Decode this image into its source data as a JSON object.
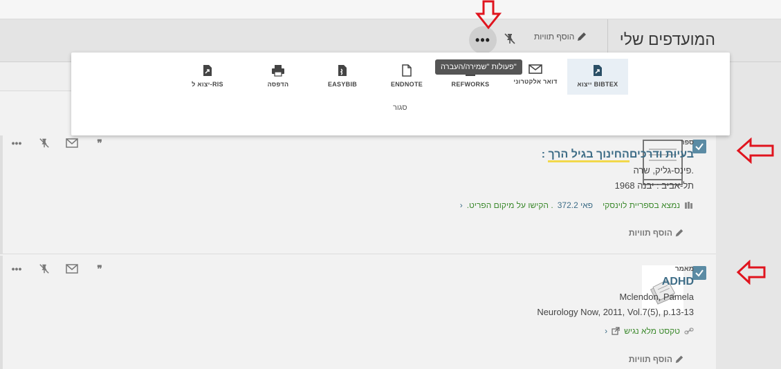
{
  "header": {
    "page_title": "המועדפים שלי",
    "add_tags": "הוסף תוויות",
    "more_label": "•••"
  },
  "popup": {
    "items": [
      {
        "label": "ייצוא BIBTEX",
        "icon": "export-icon"
      },
      {
        "label": "דואר אלקטרוני",
        "icon": "mail-icon"
      },
      {
        "label": "REFWORKS",
        "icon": "refworks-icon"
      },
      {
        "label": "ENDNOTE",
        "icon": "document-icon"
      },
      {
        "label": "EASYBIB",
        "icon": "easybib-icon"
      },
      {
        "label": "הדפסה",
        "icon": "print-icon"
      },
      {
        "label": "יצוא ל-RIS",
        "icon": "export-icon"
      }
    ],
    "close": "סגור",
    "tooltip": "פעולות \"שמירה/העברה\""
  },
  "records": [
    {
      "type": "ספר",
      "title_part1": "החינוך בגיל הרך",
      "title_part2": " : בעיות ודרכים",
      "author": "פינס-גליק, שרה.",
      "publication": "תל-אביב : יבנה 1968",
      "availability_status": "נמצא ב",
      "availability_library": "ספריית לוינסקי",
      "availability_call": "פאי 372.2",
      "availability_note": ". הקישו על מיקום הפריט.",
      "add_tags": "הוסף תוויות",
      "more": "•••",
      "quote": "❞"
    },
    {
      "type": "מאמר",
      "title": "ADHD",
      "author": "Mclendon, Pamela",
      "publication": "Neurology Now, 2011, Vol.7(5), p.13-13",
      "availability": "טקסט מלא נגיש",
      "add_tags": "הוסף תוויות",
      "more": "•••",
      "quote": "❞"
    }
  ],
  "colors": {
    "accent": "#3e6d87",
    "checkbox": "#5b8ba4",
    "available": "#3d8a2e",
    "annotation_arrow": "#e0141e"
  }
}
